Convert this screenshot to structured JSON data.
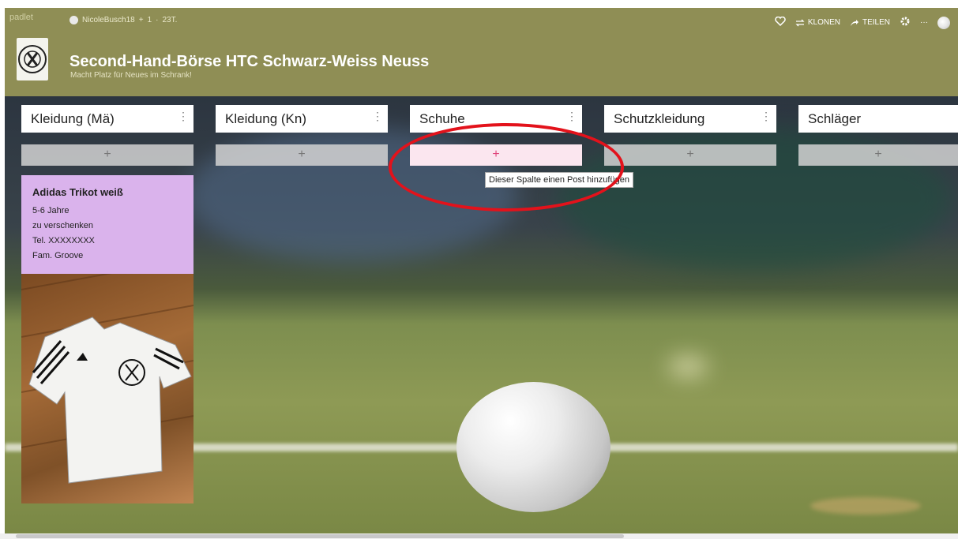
{
  "header": {
    "brand": "padlet",
    "author": "NicoleBusch18",
    "plus": "+",
    "contributors": "1",
    "separator": "·",
    "age": "23T.",
    "title": "Second-Hand-Börse HTC Schwarz-Weiss Neuss",
    "subtitle": "Macht Platz für Neues im Schrank!",
    "clone_label": "KLONEN",
    "share_label": "TEILEN",
    "more_label": "···",
    "logo_text": "HTC SCHWARZ WEISS NEUSS"
  },
  "columns": [
    {
      "title": "Kleidung (Mä)",
      "add": "+"
    },
    {
      "title": "Kleidung (Kn)",
      "add": "+"
    },
    {
      "title": "Schuhe",
      "add": "+"
    },
    {
      "title": "Schutzkleidung",
      "add": "+"
    },
    {
      "title": "Schläger",
      "add": "+"
    }
  ],
  "column_menu": "⋮",
  "tooltip": "Dieser Spalte einen Post hinzufügen",
  "post": {
    "title": "Adidas Trikot weiß",
    "lines": [
      "5-6 Jahre",
      "zu verschenken",
      "Tel. XXXXXXXX",
      "Fam. Groove"
    ]
  },
  "colors": {
    "header": "#8f8e55",
    "post": "#dab3ec",
    "highlight": "#e3121b",
    "active_add": "#fbe6ef"
  }
}
